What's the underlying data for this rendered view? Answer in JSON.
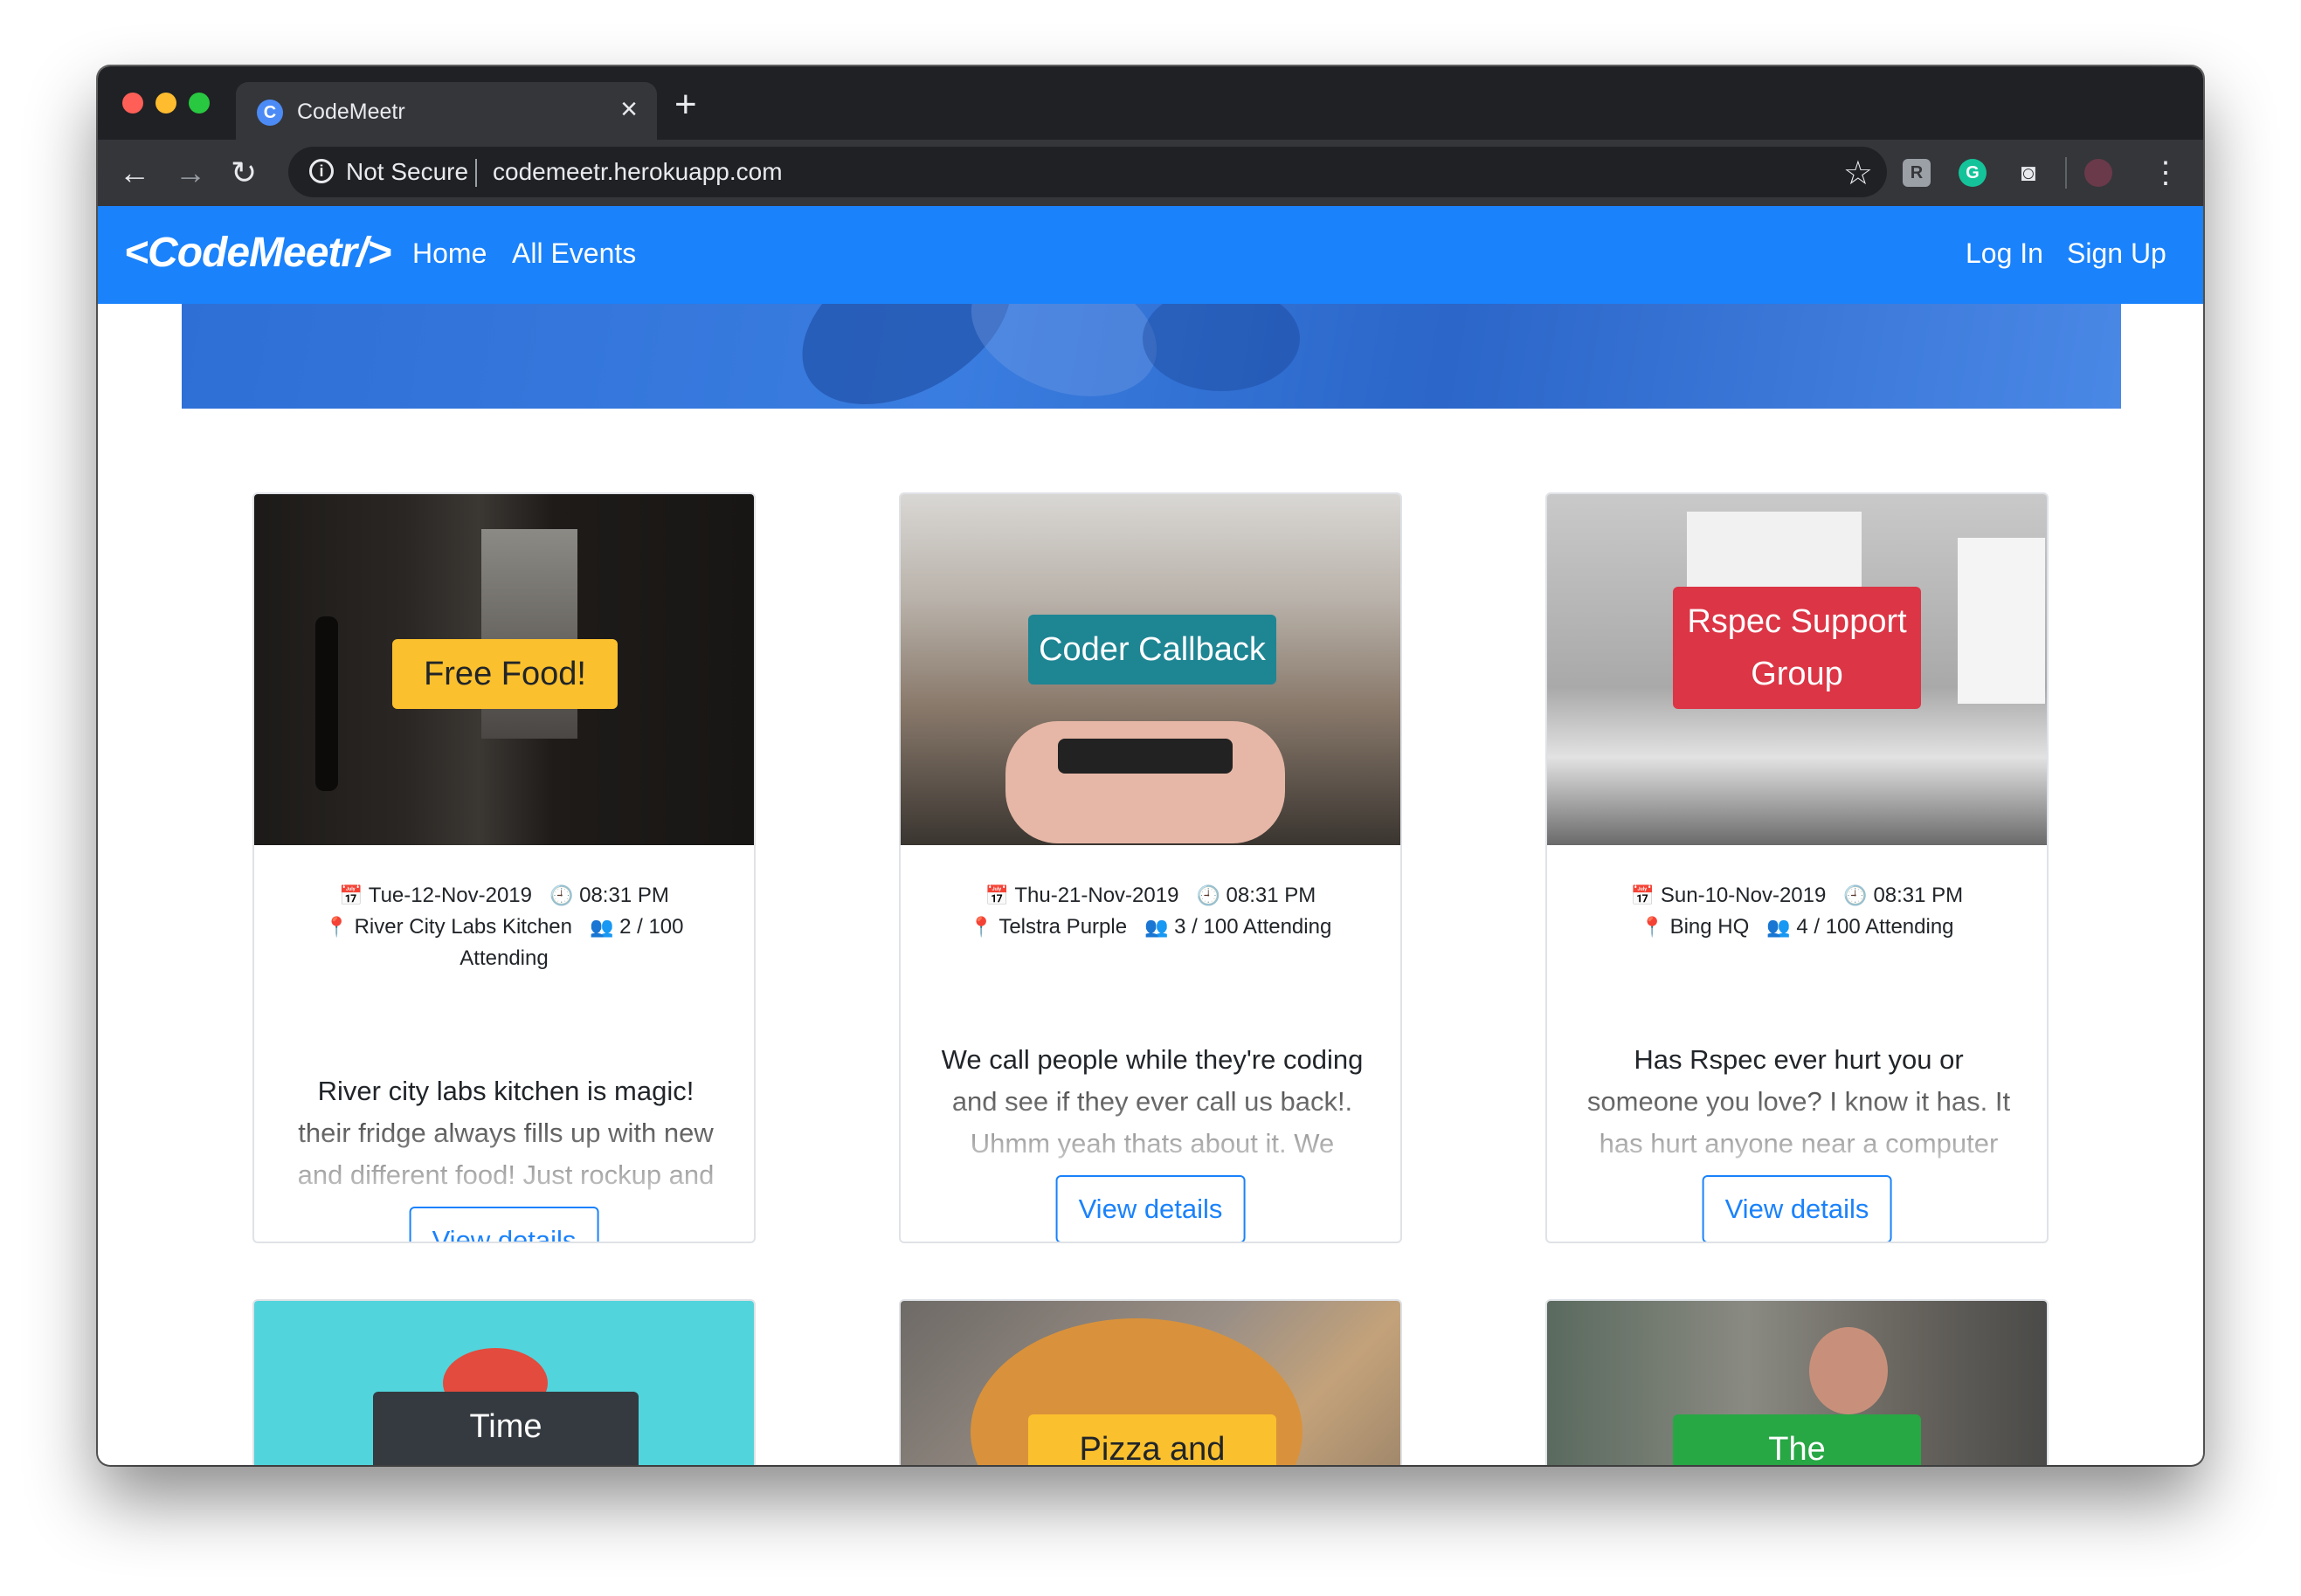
{
  "browser": {
    "tab_title": "CodeMeetr",
    "tab_favicon": "C",
    "security_label": "Not Secure",
    "url": "codemeetr.herokuapp.com",
    "close_icon": "close-icon",
    "new_tab_icon": "plus-icon"
  },
  "navbar": {
    "brand": "<CodeMeetr/>",
    "links": [
      "Home",
      "All Events"
    ],
    "right_links": [
      "Log In",
      "Sign Up"
    ],
    "color": "#1a82fb"
  },
  "cards": [
    {
      "badge": "Free Food!",
      "badge_color": "#fbc02d",
      "date": "Tue-12-Nov-2019",
      "time": "08:31 PM",
      "location": "River City Labs Kitchen",
      "attending": "2 / 100",
      "attending_label": "Attending",
      "desc_lines": [
        "River city labs kitchen is magic!",
        "their fridge always fills up with new",
        "and different food! Just rockup and"
      ],
      "button": "View details"
    },
    {
      "badge": "Coder Callback",
      "badge_color": "#1e8593",
      "date": "Thu-21-Nov-2019",
      "time": "08:31 PM",
      "location": "Telstra Purple",
      "attending": "3 / 100 Attending",
      "desc_lines": [
        "We call people while they're coding",
        "and see if they ever call us back!.",
        "Uhmm yeah thats about it. We"
      ],
      "button": "View details"
    },
    {
      "badge": "Rspec Support Group",
      "badge_color": "#dc3545",
      "date": "Sun-10-Nov-2019",
      "time": "08:31 PM",
      "location": "Bing HQ",
      "attending": "4 / 100 Attending",
      "desc_lines": [
        "Has Rspec ever hurt you or",
        "someone you love? I know it has. It",
        "has hurt anyone near a computer"
      ],
      "button": "View details"
    },
    {
      "badge": "Time",
      "badge_color": "#343a40"
    },
    {
      "badge": "Pizza and",
      "badge_color": "#fbc02d"
    },
    {
      "badge": "The",
      "badge_color": "#28a745"
    }
  ]
}
